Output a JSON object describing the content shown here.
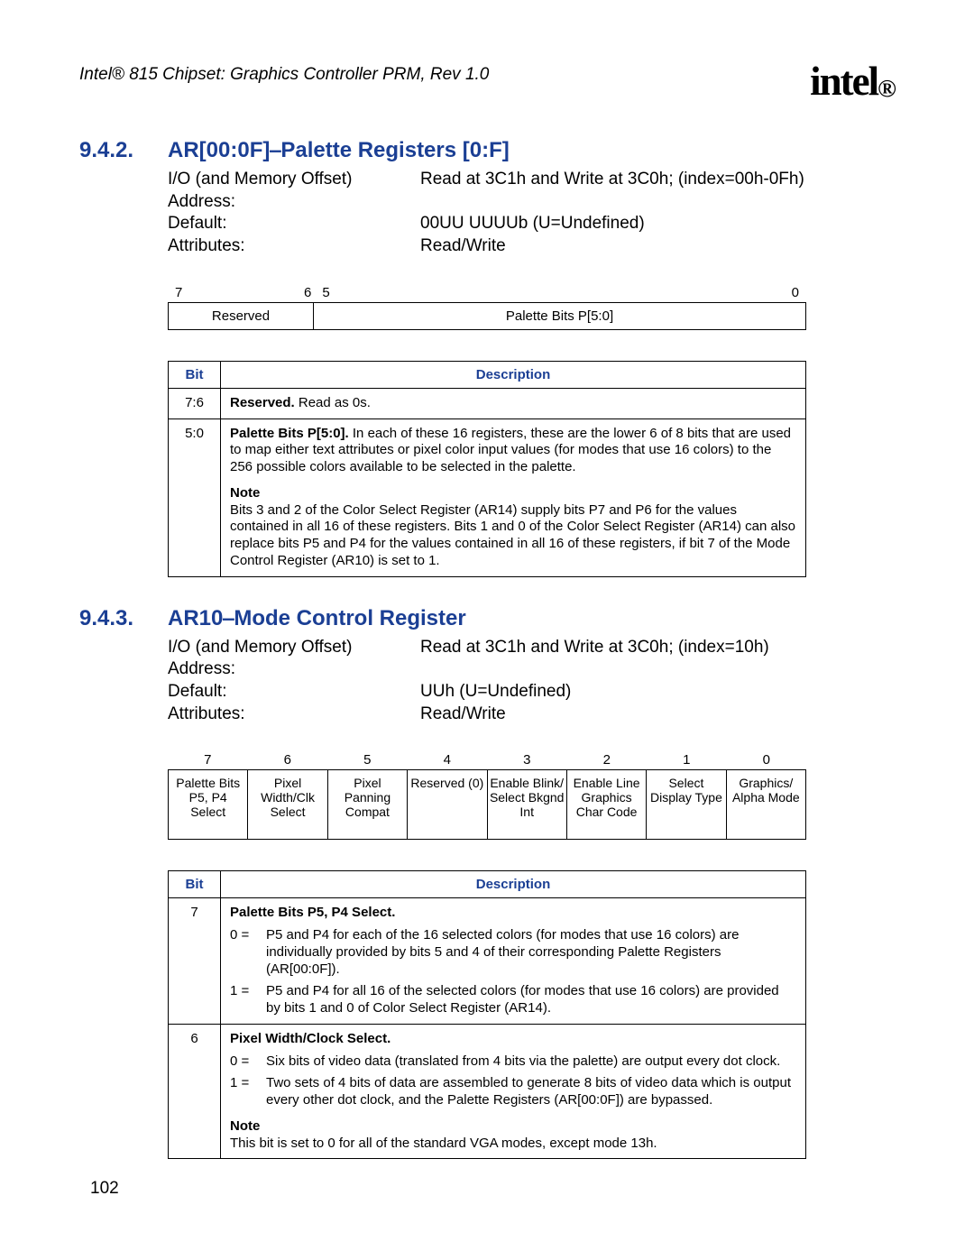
{
  "header": {
    "doc_title": "Intel® 815 Chipset: Graphics Controller PRM, Rev 1.0",
    "logo_text": "intel",
    "logo_sub": "®"
  },
  "section1": {
    "num": "9.4.2.",
    "title": "AR[00:0F]⎯Palette Registers [0:F]",
    "attrs": {
      "addr_label": "I/O (and Memory Offset) Address:",
      "addr_value": "Read at 3C1h and Write at 3C0h; (index=00h-0Fh)",
      "default_label": "Default:",
      "default_value": "00UU UUUUb (U=Undefined)",
      "attr_label": "Attributes:",
      "attr_value": "Read/Write"
    },
    "bits_layout": {
      "n7": "7",
      "n6": "6",
      "n5": "5",
      "n0": "0",
      "c0": "Reserved",
      "c1": "Palette Bits P[5:0]"
    },
    "table": {
      "h_bit": "Bit",
      "h_desc": "Description",
      "r0_bit": "7:6",
      "r0_desc_bold": "Reserved.",
      "r0_desc_rest": " Read as 0s.",
      "r1_bit": "5:0",
      "r1_desc_bold": "Palette Bits P[5:0].",
      "r1_desc_rest": " In each of these 16 registers, these are the lower 6 of 8 bits that are used to map either text attributes or pixel color input values (for modes that use 16 colors) to the 256 possible colors available to be selected in the palette.",
      "r1_note_label": "Note",
      "r1_note_body": "Bits 3 and 2 of the Color Select Register (AR14) supply bits P7 and P6 for the values contained in all 16 of these registers. Bits 1 and 0 of the Color Select Register (AR14) can also replace bits P5 and P4 for the values contained in all 16 of these registers, if bit 7 of the Mode Control Register (AR10) is set to 1."
    }
  },
  "section2": {
    "num": "9.4.3.",
    "title": "AR10⎯Mode Control Register",
    "attrs": {
      "addr_label": "I/O (and Memory Offset) Address:",
      "addr_value": "Read at 3C1h and Write at 3C0h; (index=10h)",
      "default_label": "Default:",
      "default_value": "UUh (U=Undefined)",
      "attr_label": "Attributes:",
      "attr_value": "Read/Write"
    },
    "bits_nums": {
      "n7": "7",
      "n6": "6",
      "n5": "5",
      "n4": "4",
      "n3": "3",
      "n2": "2",
      "n1": "1",
      "n0": "0"
    },
    "bits_cells": {
      "c7": "Palette Bits P5, P4 Select",
      "c6": "Pixel Width/Clk Select",
      "c5": "Pixel Panning Compat",
      "c4": "Reserved (0)",
      "c3": "Enable Blink/ Select Bkgnd Int",
      "c2": "Enable Line Graphics Char Code",
      "c1": "Select Display Type",
      "c0": "Graphics/ Alpha Mode"
    },
    "table": {
      "h_bit": "Bit",
      "h_desc": "Description",
      "r7_bit": "7",
      "r7_title": "Palette Bits P5, P4 Select.",
      "r7_0_lead": "0 =",
      "r7_0_body": "P5 and P4 for each of the 16 selected colors (for modes that use 16 colors) are individually provided by bits 5 and 4 of their corresponding Palette Registers (AR[00:0F]).",
      "r7_1_lead": "1 =",
      "r7_1_body": "P5 and P4 for all 16 of the selected colors (for modes that use 16 colors) are provided by bits 1 and 0 of Color Select Register (AR14).",
      "r6_bit": "6",
      "r6_title": "Pixel Width/Clock Select.",
      "r6_0_lead": "0 =",
      "r6_0_body": "Six bits of video data (translated from 4 bits via the palette) are output every dot clock.",
      "r6_1_lead": "1 =",
      "r6_1_body": "Two sets of 4 bits of data are assembled to generate 8 bits of video data which is output every other dot clock, and the Palette Registers (AR[00:0F]) are bypassed.",
      "r6_note_label": "Note",
      "r6_note_body": "This bit is set to 0 for all of the standard VGA modes, except mode 13h."
    }
  },
  "page_num": "102"
}
